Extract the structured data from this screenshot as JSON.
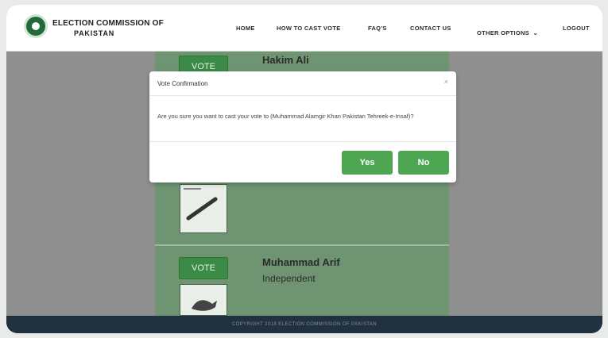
{
  "header": {
    "brand_line1": "ELECTION COMMISSION OF",
    "brand_line2": "PAKISTAN",
    "nav": [
      "HOME",
      "HOW TO CAST VOTE",
      "FAQ'S",
      "CONTACT US",
      "OTHER OPTIONS",
      "LOGOUT"
    ]
  },
  "candidates": [
    {
      "vote_label": "VOTE",
      "name": "Hakim Ali",
      "party": ""
    },
    {
      "vote_label": "VOTE",
      "name": "Muhammad Arif",
      "party": "Independent"
    }
  ],
  "modal": {
    "title": "Vote Confirmation",
    "close": "×",
    "body": "Are you sure you want to cast your vote to (Muhammad Alamgir Khan Pakistan Tehreek-e-Insaf)?",
    "yes": "Yes",
    "no": "No"
  },
  "footer": {
    "text": "COPYRIGHT 2018 ELECTION COMMISSION OF PAKISTAN"
  },
  "colors": {
    "accent": "#4ea653",
    "footer_bg": "#22313f",
    "card_bg": "#6e9471"
  }
}
